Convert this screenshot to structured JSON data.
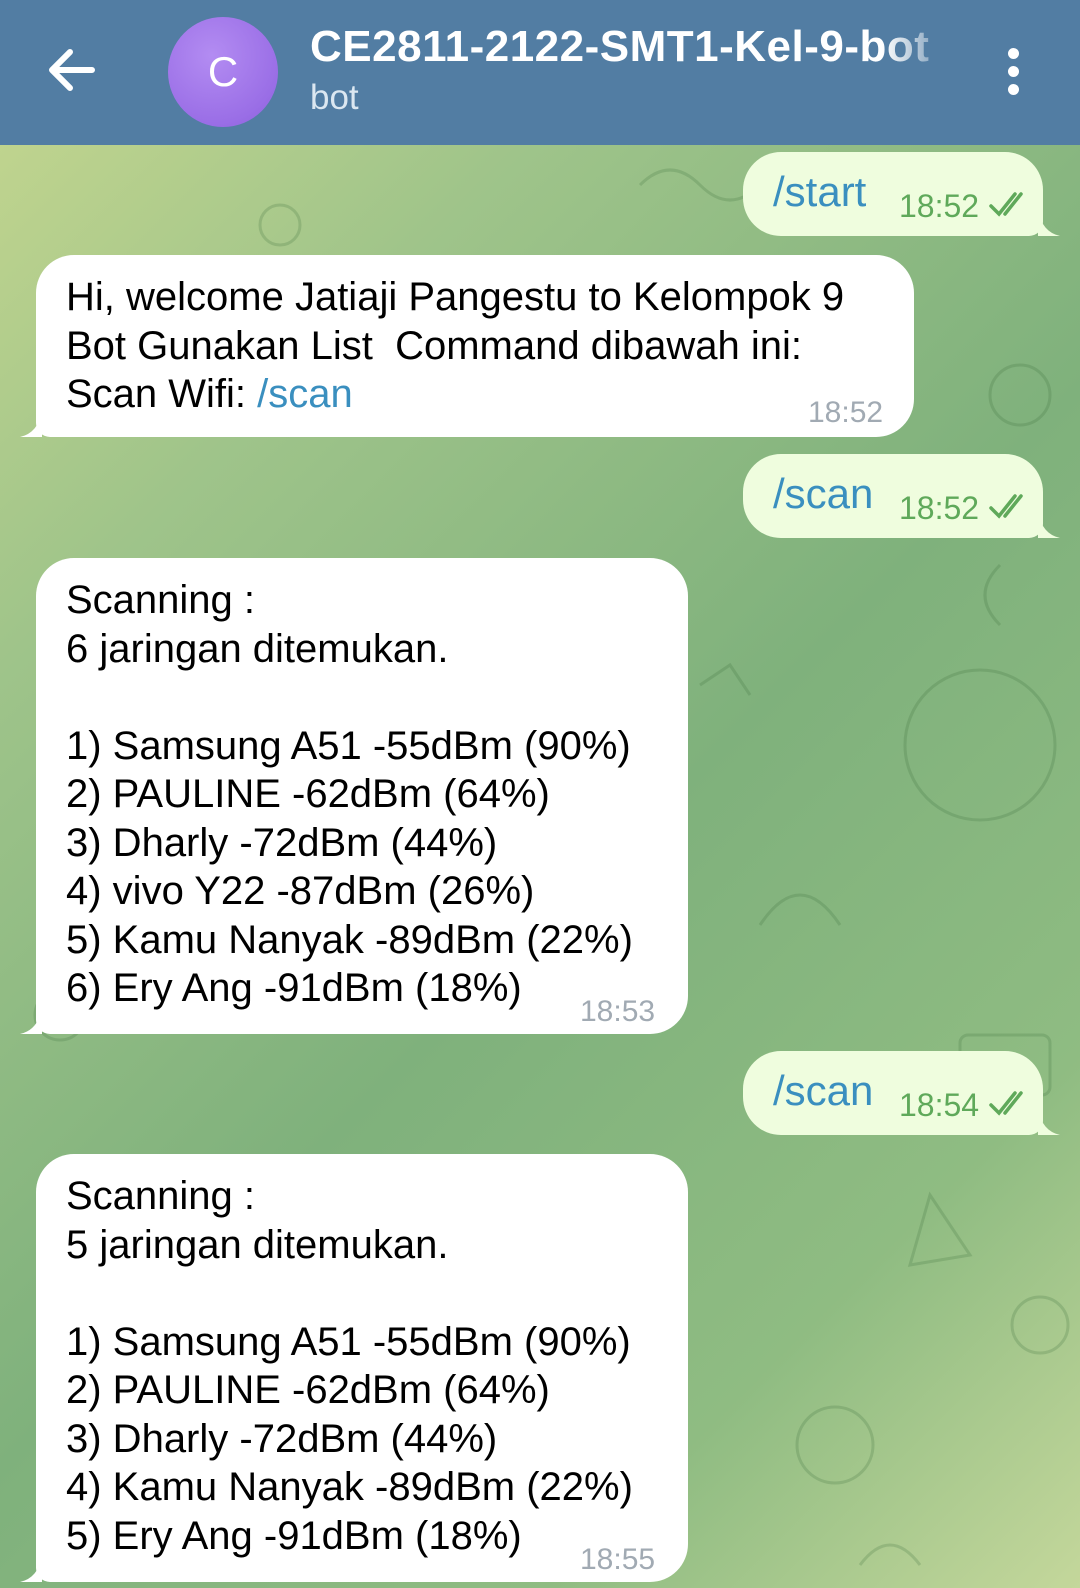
{
  "header": {
    "title": "CE2811-2122-SMT1-Kel-9-bot",
    "subtitle": "bot",
    "avatar_letter": "C",
    "back_icon": "arrow-left-icon",
    "menu_icon": "more-vertical-icon",
    "bg_color": "#527da3"
  },
  "messages": [
    {
      "direction": "out",
      "text": "/start",
      "time": "18:52",
      "status": "read"
    },
    {
      "direction": "in",
      "lines": [
        "Hi, welcome Jatiaji Pangestu to Kelompok 9",
        "Bot Gunakan List  Command dibawah ini:"
      ],
      "link_prefix": "Scan Wifi: ",
      "link": "/scan",
      "time": "18:52"
    },
    {
      "direction": "out",
      "text": "/scan",
      "time": "18:52",
      "status": "read"
    },
    {
      "direction": "in",
      "lines": [
        "Scanning :",
        "6 jaringan ditemukan.",
        "",
        "1) Samsung A51 -55dBm (90%)",
        "2) PAULINE -62dBm (64%)",
        "3) Dharly -72dBm (44%)",
        "4) vivo Y22 -87dBm (26%)",
        "5) Kamu Nanyak -89dBm (22%)",
        "6) Ery Ang -91dBm (18%)"
      ],
      "time": "18:53"
    },
    {
      "direction": "out",
      "text": "/scan",
      "time": "18:54",
      "status": "read"
    },
    {
      "direction": "in",
      "lines": [
        "Scanning :",
        "5 jaringan ditemukan.",
        "",
        "1) Samsung A51 -55dBm (90%)",
        "2) PAULINE -62dBm (64%)",
        "3) Dharly -72dBm (44%)",
        "4) Kamu Nanyak -89dBm (22%)",
        "5) Ery Ang -91dBm (18%)"
      ],
      "time": "18:55"
    }
  ],
  "colors": {
    "outgoing_bubble": "#effdde",
    "incoming_bubble": "#ffffff",
    "link": "#3a8fbf",
    "read_check": "#5fa95a"
  }
}
